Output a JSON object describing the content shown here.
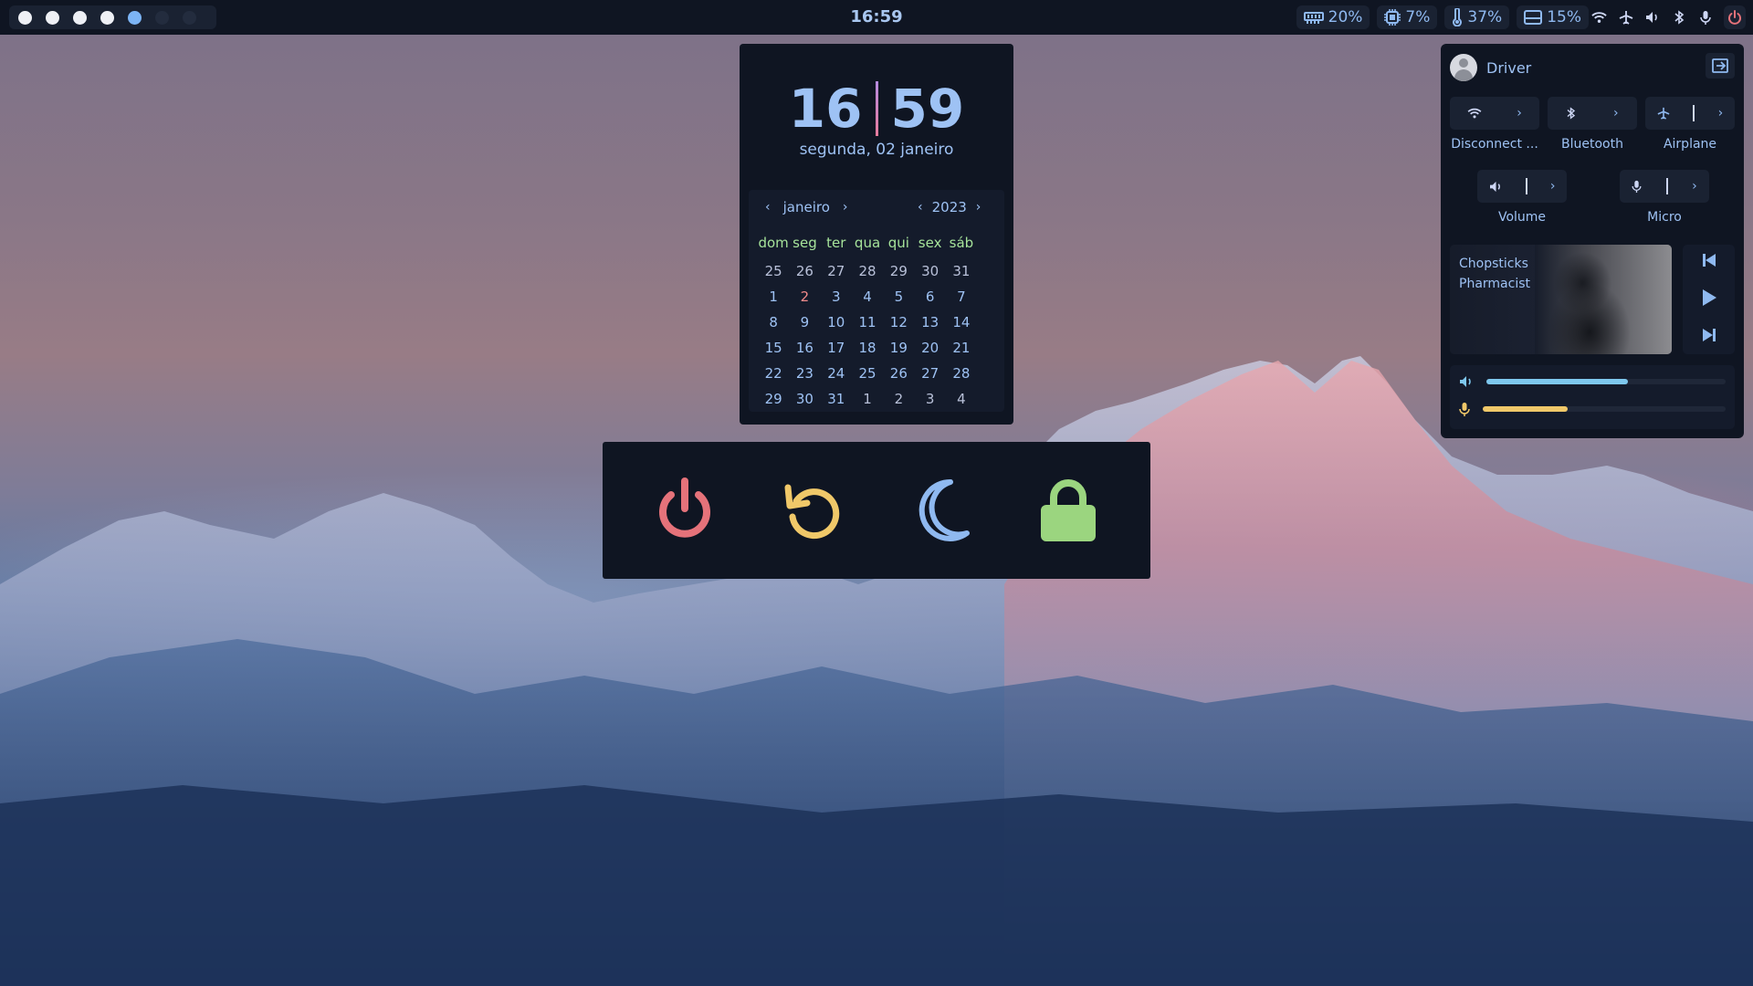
{
  "topbar": {
    "workspaces": [
      {
        "label": "1",
        "state": "occupied"
      },
      {
        "label": "2",
        "state": "occupied"
      },
      {
        "label": "3",
        "state": "occupied"
      },
      {
        "label": "4",
        "state": "occupied"
      },
      {
        "label": "5",
        "state": "active"
      },
      {
        "label": "6",
        "state": "empty"
      },
      {
        "label": "7",
        "state": "empty"
      }
    ],
    "clock": "16:59",
    "stats": {
      "ram": "20%",
      "cpu": "7%",
      "temperature": "37%",
      "disk": "15%"
    },
    "tray_icons": [
      "wifi-icon",
      "airplane-icon",
      "volume-icon",
      "bluetooth-icon",
      "microphone-icon",
      "power-icon"
    ]
  },
  "calendar_widget": {
    "hours": "16",
    "minutes": "59",
    "date": "segunda, 02 janeiro",
    "month": "janeiro",
    "year": "2023",
    "weekdays": [
      "dom",
      "seg",
      "ter",
      "qua",
      "qui",
      "sex",
      "sáb"
    ],
    "weeks": [
      [
        "25",
        "26",
        "27",
        "28",
        "29",
        "30",
        "31"
      ],
      [
        "1",
        "2",
        "3",
        "4",
        "5",
        "6",
        "7"
      ],
      [
        "8",
        "9",
        "10",
        "11",
        "12",
        "13",
        "14"
      ],
      [
        "15",
        "16",
        "17",
        "18",
        "19",
        "20",
        "21"
      ],
      [
        "22",
        "23",
        "24",
        "25",
        "26",
        "27",
        "28"
      ],
      [
        "29",
        "30",
        "31",
        "1",
        "2",
        "3",
        "4"
      ]
    ],
    "today": "2"
  },
  "power_menu": {
    "buttons": [
      "shutdown",
      "reboot",
      "sleep",
      "lock"
    ],
    "colors": {
      "shutdown": "#e5727a",
      "reboot": "#f0c869",
      "sleep": "#8fb9f0",
      "lock": "#9bd57f"
    }
  },
  "quick_settings": {
    "username": "Driver",
    "toggles": [
      {
        "label": "Disconnect ...",
        "icon": "wifi-icon"
      },
      {
        "label": "Bluetooth",
        "icon": "bluetooth-icon"
      },
      {
        "label": "Airplane",
        "icon": "airplane-icon"
      },
      {
        "label": "Volume",
        "icon": "volume-icon"
      },
      {
        "label": "Micro",
        "icon": "microphone-icon"
      }
    ],
    "media": {
      "title": "Chopsticks Pharmacist"
    },
    "volume_level": 0.59,
    "mic_level": 0.35,
    "colors": {
      "volume": "#7ec8ee",
      "mic": "#f0c869"
    }
  }
}
